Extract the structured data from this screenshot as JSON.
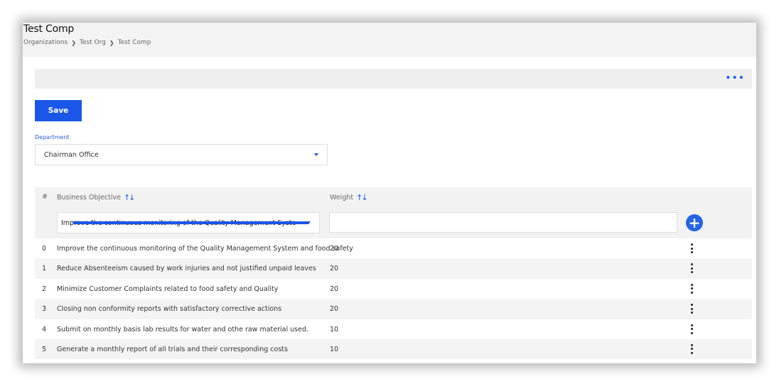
{
  "header": {
    "title": "Test Comp",
    "breadcrumb": [
      "Organizations",
      "Test Org",
      "Test Comp"
    ]
  },
  "toolbar": {
    "more_icon": "more-horizontal-icon"
  },
  "actions": {
    "save_label": "Save"
  },
  "department": {
    "label": "Department",
    "selected": "Chairman Office"
  },
  "table": {
    "headers": {
      "index": "#",
      "objective": "Business Objective",
      "weight": "Weight"
    },
    "new_row": {
      "objective_selected": "Improve the continuous monitoring of the Quality Management System and f",
      "weight_value": ""
    },
    "rows": [
      {
        "index": "0",
        "objective": "Improve the continuous monitoring of the Quality Management System and food safety",
        "weight": "20"
      },
      {
        "index": "1",
        "objective": "Reduce Absenteeism caused by work injuries and not justified unpaid leaves",
        "weight": "20"
      },
      {
        "index": "2",
        "objective": "Minimize Customer Complaints related to food safety and Quality",
        "weight": "20"
      },
      {
        "index": "3",
        "objective": "Closing non conformity reports with satisfactory corrective actions",
        "weight": "20"
      },
      {
        "index": "4",
        "objective": "Submit on monthly basis lab results for water and othe raw material used.",
        "weight": "10"
      },
      {
        "index": "5",
        "objective": "Generate a monthly report of all trials and their corresponding costs",
        "weight": "10"
      }
    ]
  },
  "colors": {
    "accent": "#1a56e8",
    "header_bg": "#f3f3f3",
    "row_alt": "#f4f4f4"
  }
}
